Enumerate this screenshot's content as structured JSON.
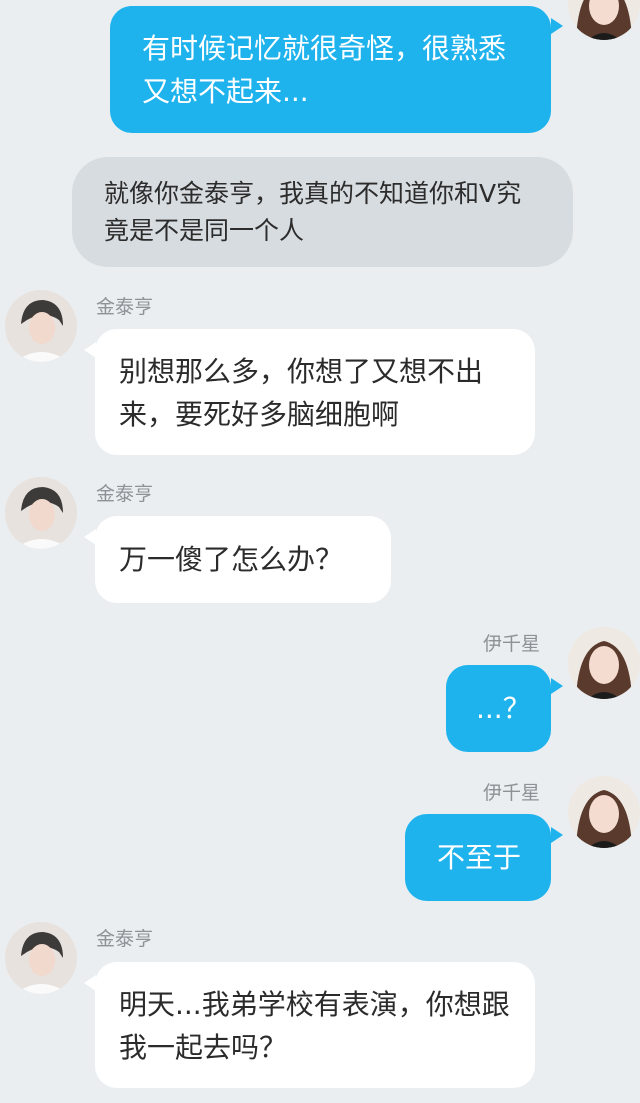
{
  "contacts": {
    "other": {
      "name": "金泰亨"
    },
    "me": {
      "name": "伊千星"
    }
  },
  "messages": [
    {
      "sender": "me",
      "text": "有时候记忆就很奇怪，很熟悉又想不起来..."
    },
    {
      "sender": "system",
      "text": "就像你金泰亨，我真的不知道你和V究竟是不是同一个人"
    },
    {
      "sender": "other",
      "name": "金泰亨",
      "text": "别想那么多，你想了又想不出来，要死好多脑细胞啊"
    },
    {
      "sender": "other",
      "name": "金泰亨",
      "text": "万一傻了怎么办？"
    },
    {
      "sender": "me",
      "name": "伊千星",
      "text": "...？"
    },
    {
      "sender": "me",
      "name": "伊千星",
      "text": "不至于"
    },
    {
      "sender": "other",
      "name": "金泰亨",
      "text": "明天...我弟学校有表演，你想跟我一起去吗？"
    }
  ],
  "colors": {
    "background": "#eaeef1",
    "outgoing_bubble": "#1fb3ee",
    "incoming_bubble": "#ffffff",
    "narration_bubble": "#d7dce0",
    "name_text": "#8d9297"
  }
}
